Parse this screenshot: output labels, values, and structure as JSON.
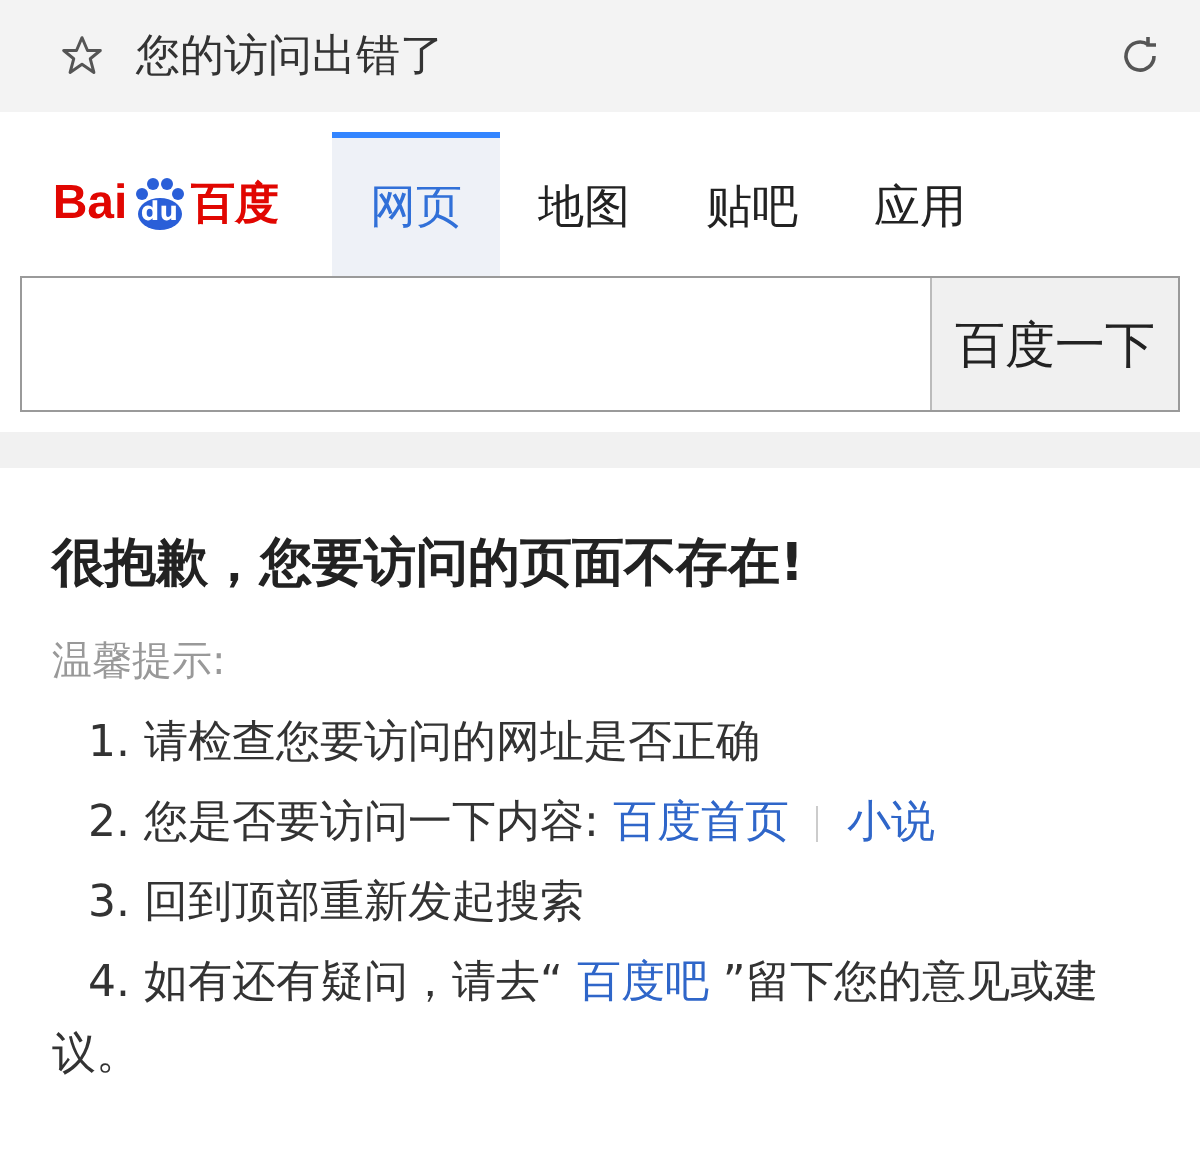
{
  "address_bar": {
    "title": "您的访问出错了"
  },
  "logo": {
    "left": "Bai",
    "badge": "du",
    "right": "百度"
  },
  "tabs": [
    {
      "label": "网页",
      "selected": true
    },
    {
      "label": "地图",
      "selected": false
    },
    {
      "label": "贴吧",
      "selected": false
    },
    {
      "label": "应用",
      "selected": false
    }
  ],
  "search": {
    "button": "百度一下"
  },
  "error": {
    "heading": "很抱歉，您要访问的页面不存在!",
    "hint": "温馨提示:",
    "items": [
      {
        "kind": "text",
        "text": "1. 请检查您要访问的网址是否正确"
      },
      {
        "kind": "links",
        "text": "2. 您是否要访问一下内容:",
        "links": [
          "百度首页",
          "小说"
        ]
      },
      {
        "kind": "text",
        "text": "3. 回到顶部重新发起搜索"
      },
      {
        "kind": "inline_link",
        "before": "4. 如有还有疑问，请去“",
        "link": "百度吧",
        "after": "”留下您的意见或建议。"
      }
    ]
  }
}
